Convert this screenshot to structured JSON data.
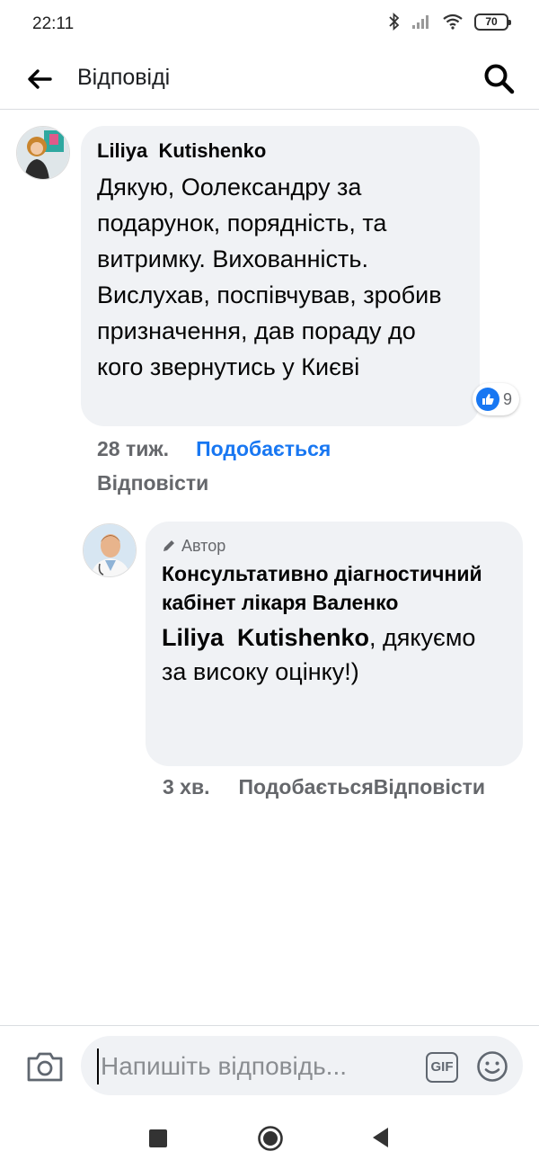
{
  "status_bar": {
    "time": "22:11",
    "battery": "70"
  },
  "header": {
    "title": "Відповіді",
    "back_icon": "arrow-left-icon",
    "search_icon": "search-icon"
  },
  "comments": [
    {
      "author": "Liliya  Kutishenko",
      "text": "Дякую, Оолександру за подарунок, порядність, та витримку. Вихованність. Вислухав, поспівчував, зробив призначення, дав пораду до кого звернутись у Києві",
      "reaction_count": "9",
      "time": "28 тиж.",
      "like_label": "Подобається",
      "reply_label": "Відповісти"
    },
    {
      "author_badge": "Автор",
      "author": "Консультативно діагностичний кабінет лікаря Валенко",
      "mention": "Liliya  Kutishenko",
      "text": ", дякуємо за високу оцінку!)",
      "time": "3 хв.",
      "like_label": "Подобається",
      "reply_label": "Відповісти"
    }
  ],
  "composer": {
    "placeholder": "Напишіть відповідь...",
    "gif_label": "GIF",
    "camera_icon": "camera-icon",
    "emoji_icon": "emoji-icon"
  },
  "colors": {
    "bubble": "#f0f2f5",
    "accent": "#1877f2",
    "secondary_text": "#65676b"
  }
}
